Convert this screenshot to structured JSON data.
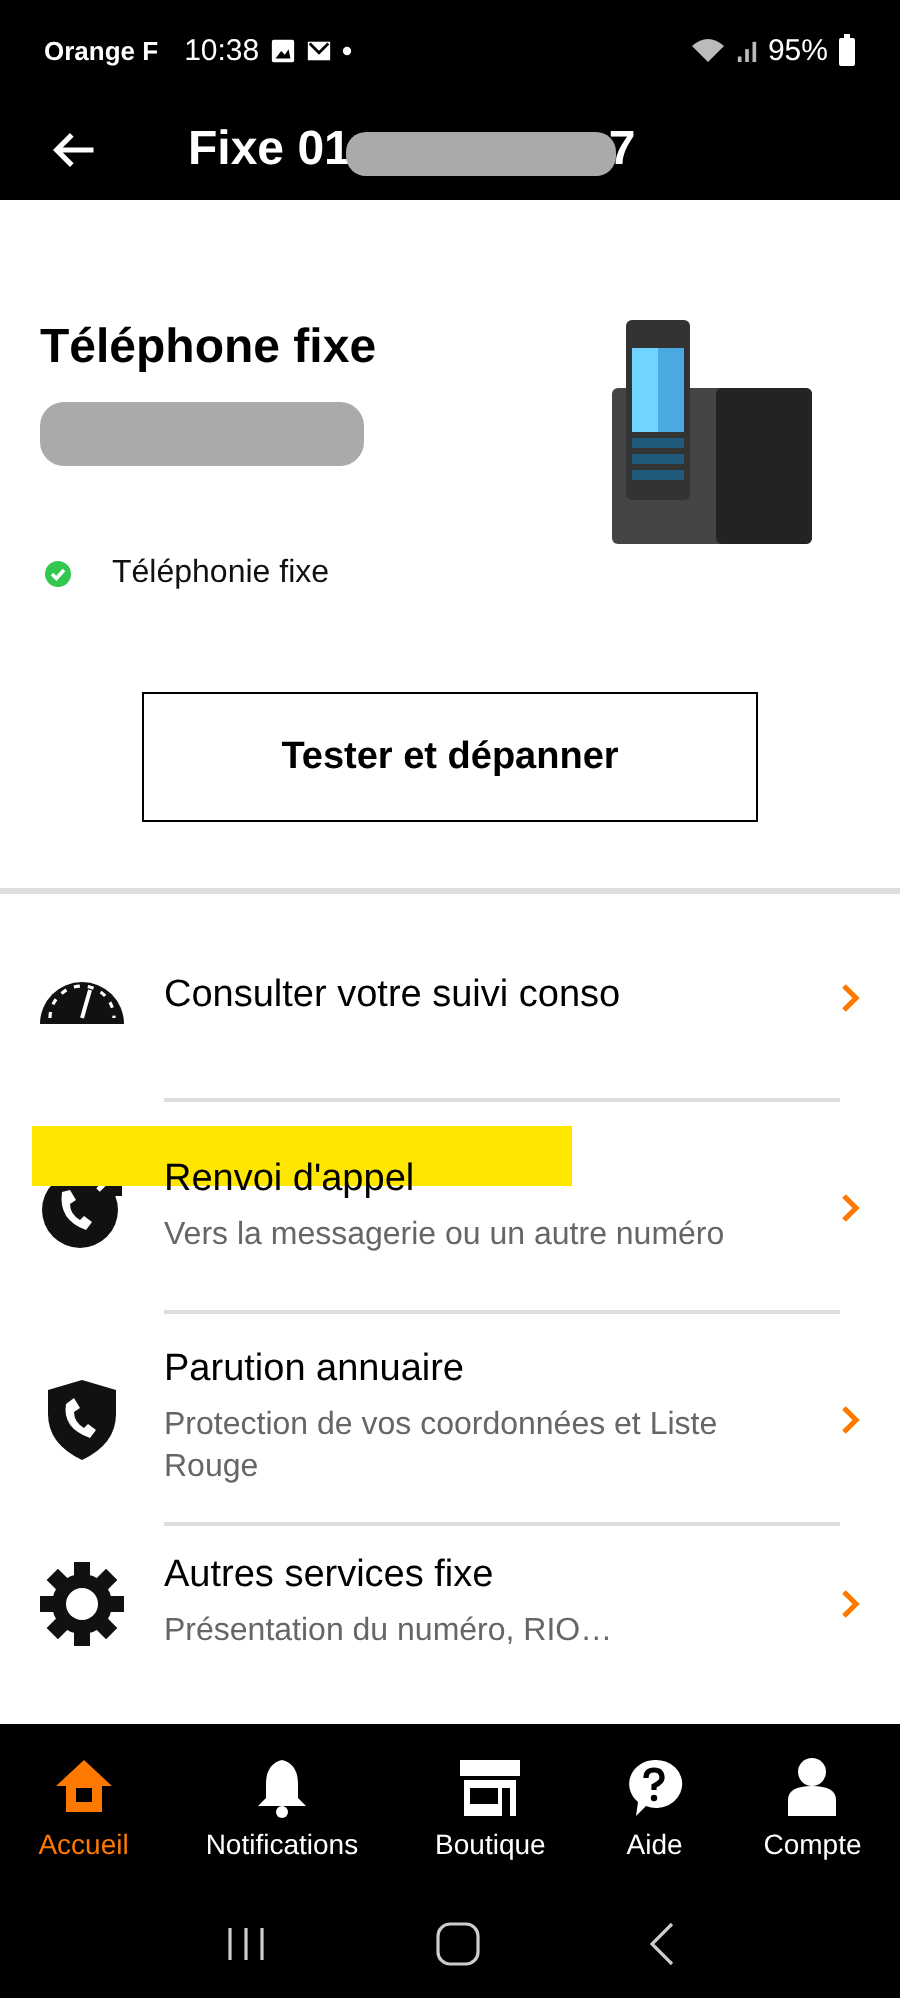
{
  "status_bar": {
    "carrier": "Orange F",
    "time": "10:38",
    "battery": "95%"
  },
  "app_bar": {
    "title": "Fixe 01",
    "title_end": "7"
  },
  "line": {
    "title": "Téléphone fixe",
    "service": {
      "label": "Téléphonie fixe",
      "active": true
    }
  },
  "test_button": "Tester et dépanner",
  "menu": [
    {
      "kind": "gauge",
      "title": "Consulter votre suivi conso",
      "highlighted": false
    },
    {
      "kind": "forward",
      "title": "Renvoi d'appel",
      "subtitle": "Vers la messagerie ou un autre numéro",
      "highlighted": true
    },
    {
      "kind": "shield",
      "title": "Parution annuaire",
      "subtitle": "Protection de vos coordonnées et Liste Rouge",
      "highlighted": false
    },
    {
      "kind": "gear",
      "title": "Autres services fixe",
      "subtitle": "Présentation du numéro, RIO…",
      "highlighted": false
    }
  ],
  "tab_bar": [
    {
      "kind": "home",
      "label": "Accueil",
      "selected": true
    },
    {
      "kind": "bell",
      "label": "Notifications",
      "selected": false
    },
    {
      "kind": "shop",
      "label": "Boutique",
      "selected": false
    },
    {
      "kind": "help",
      "label": "Aide",
      "selected": false
    },
    {
      "kind": "user",
      "label": "Compte",
      "selected": false
    }
  ]
}
